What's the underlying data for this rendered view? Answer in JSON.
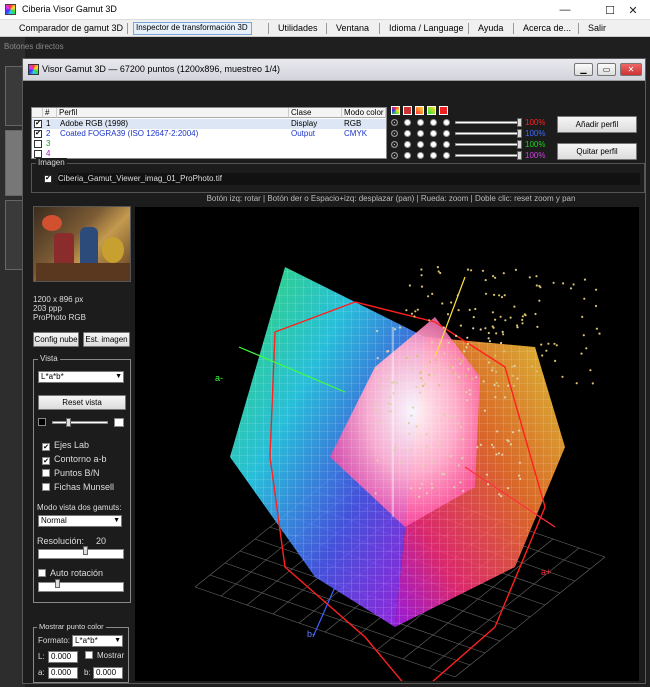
{
  "app": {
    "title": "Ciberia Visor Gamut 3D"
  },
  "window_controls": {
    "minimize": "—",
    "maximize": "☐",
    "close": "✕"
  },
  "menu": [
    {
      "label": "Comparador de gamut 3D"
    },
    {
      "label": "Inspector de transformación 3D"
    },
    {
      "label": "Utilidades"
    },
    {
      "label": "Ventana"
    },
    {
      "label": "Idioma / Language"
    },
    {
      "label": "Ayuda"
    },
    {
      "label": "Acerca de..."
    },
    {
      "label": "Salir"
    }
  ],
  "side": {
    "botones_label": "Botones directos"
  },
  "subwindow": {
    "title": "Visor Gamut 3D — 67200 puntos (1200x896, muestreo 1/4)"
  },
  "profiles": {
    "headers": {
      "num": "#",
      "perfil": "Perfil",
      "clase": "Clase",
      "modo": "Modo color"
    },
    "rows": [
      {
        "checked": "✔",
        "num": "1",
        "perfil": "Adobe RGB (1998)",
        "clase": "Display",
        "modo": "RGB",
        "color": "#000000",
        "swatch": "#ff2020",
        "pct": "100%",
        "pct_color": "#ff2020",
        "level": 1.0
      },
      {
        "checked": "✔",
        "num": "2",
        "perfil": "Coated FOGRA39 (ISO 12647-2:2004)",
        "clase": "Output",
        "modo": "CMYK",
        "color": "#1a34c8",
        "swatch": "#2050ff",
        "pct": "100%",
        "pct_color": "#3a6bff",
        "level": 1.0
      },
      {
        "checked": "",
        "num": "3",
        "perfil": "",
        "clase": "",
        "modo": "",
        "color": "#20a020",
        "swatch": "#20c020",
        "pct": "100%",
        "pct_color": "#20d020",
        "level": 1.0
      },
      {
        "checked": "",
        "num": "4",
        "perfil": "",
        "clase": "",
        "modo": "",
        "color": "#b020c0",
        "swatch": "#c020d0",
        "pct": "100%",
        "pct_color": "#d040e0",
        "level": 1.0
      }
    ],
    "add_button": "Añadir perfil",
    "remove_button": "Quitar perfil"
  },
  "image": {
    "legend": "Imagen",
    "checked": "✔",
    "filename": "Ciberia_Gamut_Viewer_imag_01_ProPhoto.tif"
  },
  "hint": "Botón izq: rotar  |  Botón der o Espacio+izq: desplazar (pan)  |  Rueda: zoom  |  Doble clic: reset zoom y pan",
  "image_info": {
    "size": "1200 x 896 px",
    "ppp": "203 ppp",
    "profile": "ProPhoto RGB",
    "config_button": "Config nube",
    "est_button": "Est. imagen"
  },
  "vista": {
    "legend": "Vista",
    "mode_select": "L*a*b*",
    "reset_button": "Reset vista",
    "brightness_level": 0.25,
    "checks": [
      {
        "label": "Ejes Lab",
        "checked": "✔"
      },
      {
        "label": "Contorno a-b",
        "checked": "✔"
      },
      {
        "label": "Puntos B/N",
        "checked": ""
      },
      {
        "label": "Fichas Munsell",
        "checked": ""
      }
    ],
    "dos_gamuts_label": "Modo vista dos gamuts:",
    "dos_gamuts_value": "Normal",
    "resolucion_label": "Resolución:",
    "resolucion_value": "20",
    "resolucion_level": 0.55,
    "auto_label": "Auto rotación",
    "auto_checked": "",
    "auto_level": 0.2
  },
  "mostrar": {
    "legend": "Mostrar punto color",
    "formato_label": "Formato:",
    "formato_value": "L*a*b*",
    "L_label": "L:",
    "L_value": "0.000",
    "mostrar_label": "Mostrar",
    "a_label": "a:",
    "a_value": "0.000",
    "b_label": "b:",
    "b_value": "0.000"
  },
  "axes": {
    "a_neg": "a-",
    "a_pos": "a+",
    "b_neg": "b-"
  },
  "colors": {
    "axis_a_neg": "#40ff40",
    "axis_a_pos": "#ff3040",
    "axis_b_neg": "#4060ff",
    "red_gamut": "#ff2020",
    "blue_gamut": "#2040ff"
  }
}
